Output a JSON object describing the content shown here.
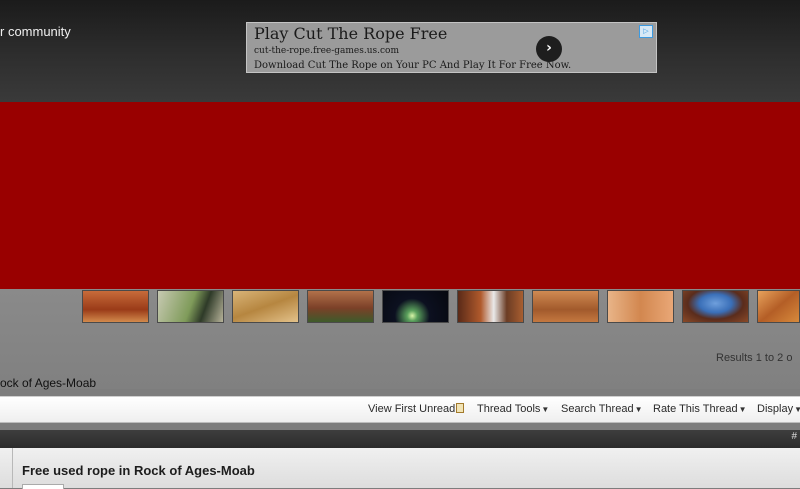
{
  "header": {
    "tagline": "r community"
  },
  "ad": {
    "title": "Play Cut The Rope Free",
    "url": "cut-the-rope.free-games.us.com",
    "description": "Download Cut The Rope on Your PC And Play It For Free Now."
  },
  "banner": {
    "color": "#990000"
  },
  "thumbnails": [
    {
      "name": "red-canyon-thumbnail"
    },
    {
      "name": "desert-bush-thumbnail"
    },
    {
      "name": "sandstone-thumbnail"
    },
    {
      "name": "ruins-thumbnail"
    },
    {
      "name": "night-tent-thumbnail"
    },
    {
      "name": "waterfall-thumbnail"
    },
    {
      "name": "cliff-dwelling-thumbnail"
    },
    {
      "name": "canyon-wall-thumbnail"
    },
    {
      "name": "arch-sky-thumbnail"
    },
    {
      "name": "orange-rocks-thumbnail"
    }
  ],
  "results_text": "Results 1 to 2 o",
  "breadcrumb": "ock of Ages-Moab",
  "toolbar": {
    "view_first_unread": "View First Unread",
    "thread_tools": "Thread Tools",
    "search_thread": "Search Thread",
    "rate_thread": "Rate This Thread",
    "display": "Display"
  },
  "post_header": {
    "hash": "#"
  },
  "post": {
    "title": "Free used rope in Rock of Ages-Moab"
  }
}
